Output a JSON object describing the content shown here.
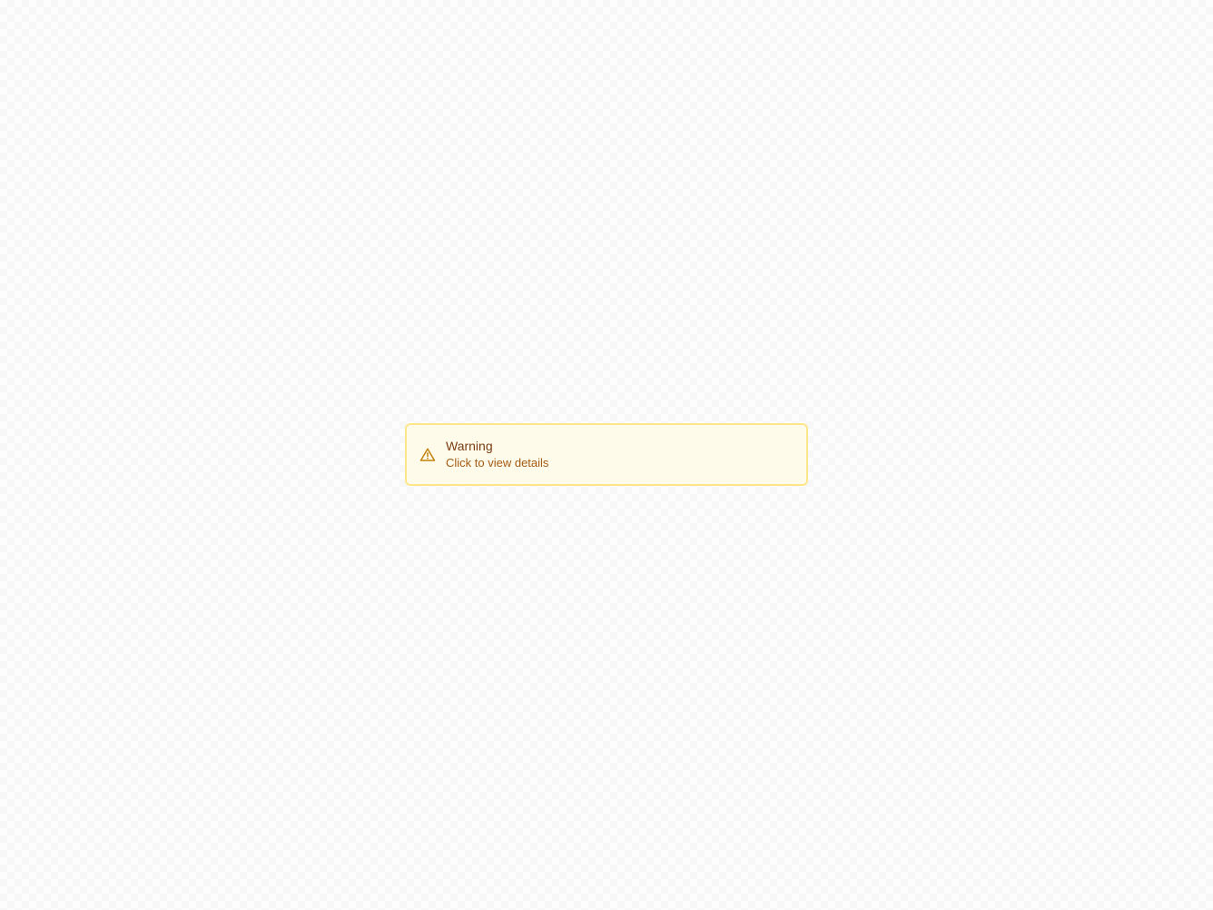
{
  "alert": {
    "title": "Warning",
    "subtitle": "Click to view details",
    "icon": "warning-triangle-icon",
    "colors": {
      "border": "#fde68a",
      "background": "#fffbea",
      "icon": "#c2820a",
      "title": "#7a3c12",
      "subtitle": "#a35a13"
    }
  }
}
